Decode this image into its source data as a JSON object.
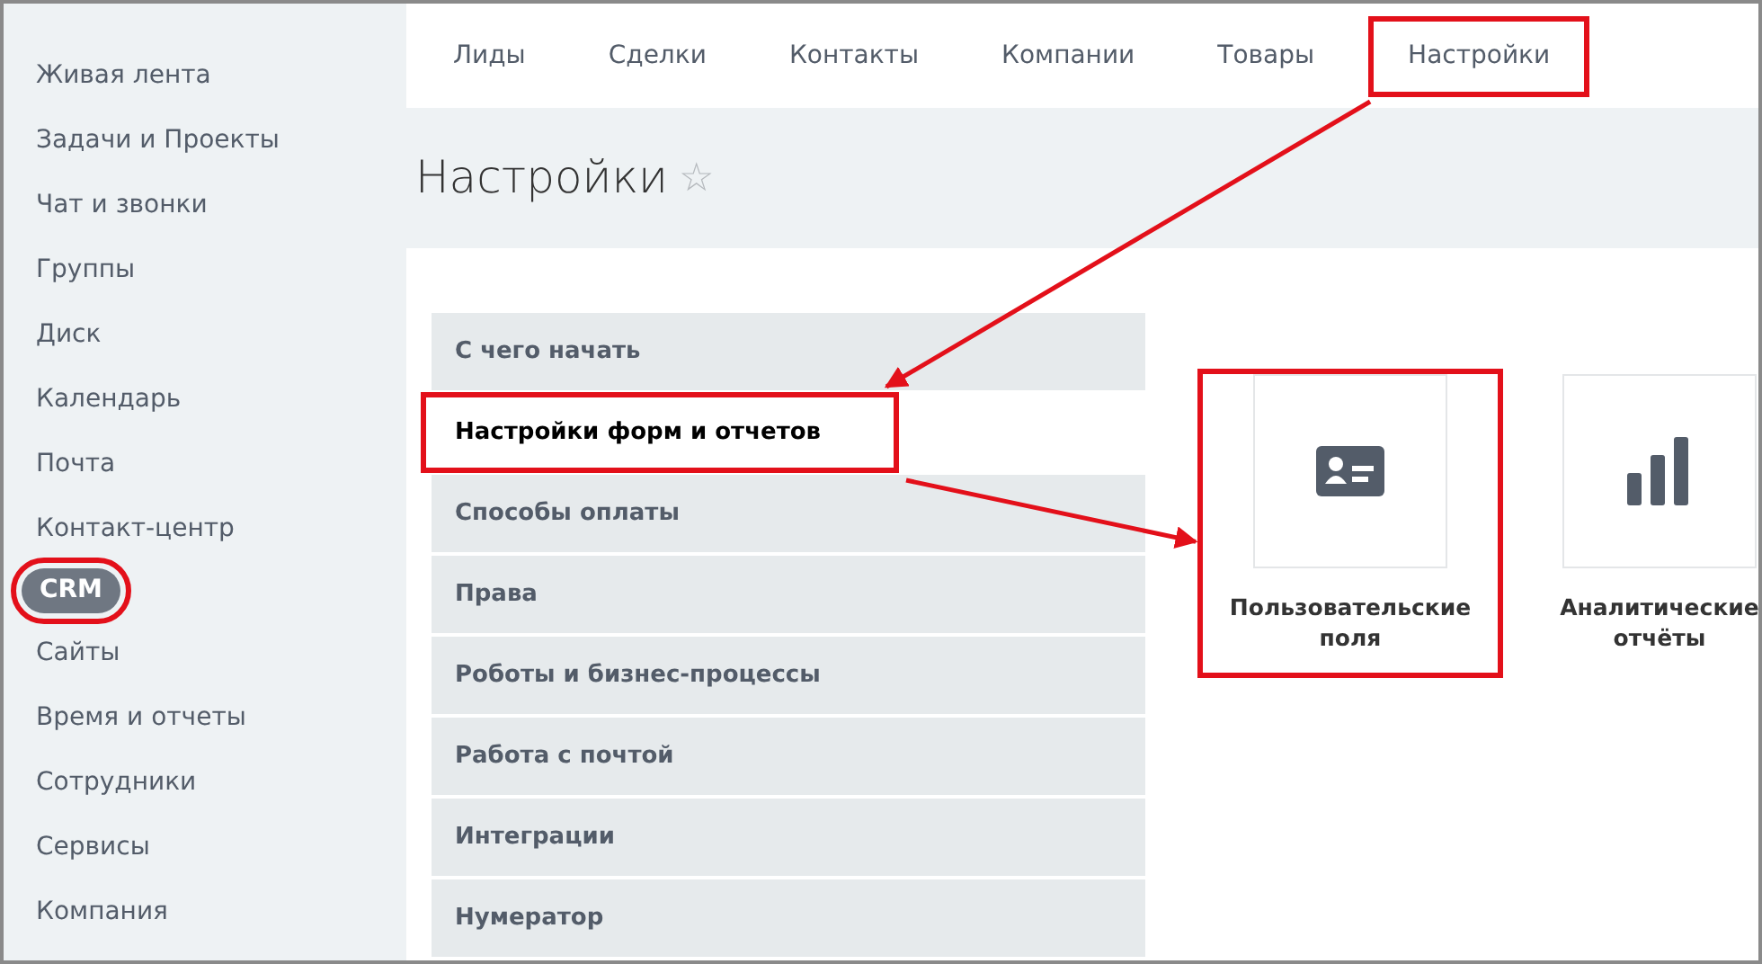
{
  "sidebar": {
    "items": [
      {
        "label": "Живая лента",
        "selected": false,
        "highlighted": false
      },
      {
        "label": "Задачи и Проекты",
        "selected": false,
        "highlighted": false
      },
      {
        "label": "Чат и звонки",
        "selected": false,
        "highlighted": false
      },
      {
        "label": "Группы",
        "selected": false,
        "highlighted": false
      },
      {
        "label": "Диск",
        "selected": false,
        "highlighted": false
      },
      {
        "label": "Календарь",
        "selected": false,
        "highlighted": false
      },
      {
        "label": "Почта",
        "selected": false,
        "highlighted": false
      },
      {
        "label": "Контакт-центр",
        "selected": false,
        "highlighted": false
      },
      {
        "label": "CRM",
        "selected": true,
        "highlighted": true
      },
      {
        "label": "Сайты",
        "selected": false,
        "highlighted": false
      },
      {
        "label": "Время и отчеты",
        "selected": false,
        "highlighted": false
      },
      {
        "label": "Сотрудники",
        "selected": false,
        "highlighted": false
      },
      {
        "label": "Сервисы",
        "selected": false,
        "highlighted": false
      },
      {
        "label": "Компания",
        "selected": false,
        "highlighted": false
      }
    ]
  },
  "tabs": [
    {
      "label": "Лиды",
      "selected": false,
      "highlighted": false
    },
    {
      "label": "Сделки",
      "selected": false,
      "highlighted": false
    },
    {
      "label": "Контакты",
      "selected": false,
      "highlighted": false
    },
    {
      "label": "Компании",
      "selected": false,
      "highlighted": false
    },
    {
      "label": "Товары",
      "selected": false,
      "highlighted": false
    },
    {
      "label": "Настройки",
      "selected": false,
      "highlighted": true,
      "arrow": true
    }
  ],
  "page_title": {
    "text": "Настройки",
    "star": "☆"
  },
  "settings_menu": [
    {
      "label": "С чего начать",
      "selected": false,
      "highlighted": false
    },
    {
      "label": "Настройки форм и отчетов",
      "selected": true,
      "highlighted": true,
      "arrow": true
    },
    {
      "label": "Способы оплаты",
      "selected": false,
      "highlighted": false
    },
    {
      "label": "Права",
      "selected": false,
      "highlighted": false
    },
    {
      "label": "Роботы и бизнес-процессы",
      "selected": false,
      "highlighted": false
    },
    {
      "label": "Работа с почтой",
      "selected": false,
      "highlighted": false
    },
    {
      "label": "Интеграции",
      "selected": false,
      "highlighted": false
    },
    {
      "label": "Нумератор",
      "selected": false,
      "highlighted": false
    }
  ],
  "tiles": [
    {
      "label": "Пользовательские поля",
      "kind": "card",
      "highlighted": true
    },
    {
      "label": "Аналитические отчёты",
      "kind": "chart",
      "highlighted": false
    }
  ]
}
